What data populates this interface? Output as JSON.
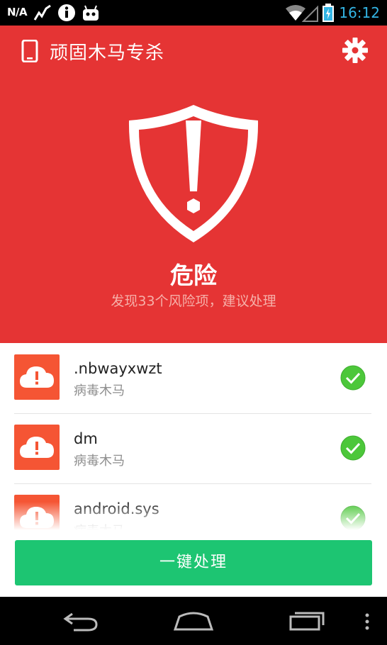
{
  "status_bar": {
    "carrier": "N/A",
    "time": "16:12"
  },
  "header": {
    "title": "顽固木马专杀"
  },
  "scan_result": {
    "status": "危险",
    "summary": "发现33个风险项，建议处理"
  },
  "threats": [
    {
      "name": ".nbwayxwzt",
      "type": "病毒木马"
    },
    {
      "name": "dm",
      "type": "病毒木马"
    },
    {
      "name": "android.sys",
      "type": "病毒木马"
    }
  ],
  "action": {
    "label": "一键处理"
  },
  "colors": {
    "danger": "#e53434",
    "item_icon": "#f55534",
    "success": "#1dc572",
    "check": "#4cc73a"
  }
}
